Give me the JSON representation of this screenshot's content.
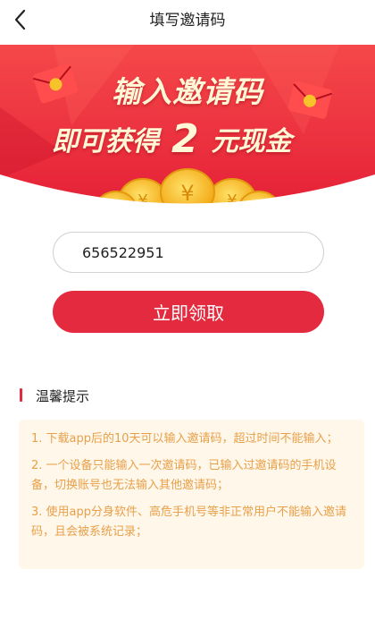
{
  "nav": {
    "title": "填写邀请码",
    "back_icon": "back-arrow-icon"
  },
  "banner": {
    "line1": "输入邀请码",
    "line2_prefix": "即可获得",
    "amount": "2",
    "line2_suffix": "元现金",
    "colors": {
      "primary": "#e8303c",
      "gold": "#f7c22a",
      "text": "#fff7d6"
    }
  },
  "form": {
    "invite_code": "656522951",
    "claim_label": "立即领取"
  },
  "tips": {
    "title": "温馨提示",
    "items": [
      "1. 下载app后的10天可以输入邀请码，超过时间不能输入；",
      "2. 一个设备只能输入一次邀请码，已输入过邀请码的手机设备，切换账号也无法输入其他邀请码；",
      "3. 使用app分身软件、高危手机号等非正常用户不能输入邀请码，且会被系统记录；"
    ]
  },
  "theme": {
    "accent": "#e32a3f",
    "tips_bg": "#fff7ea",
    "tips_text": "#e8a04a"
  }
}
